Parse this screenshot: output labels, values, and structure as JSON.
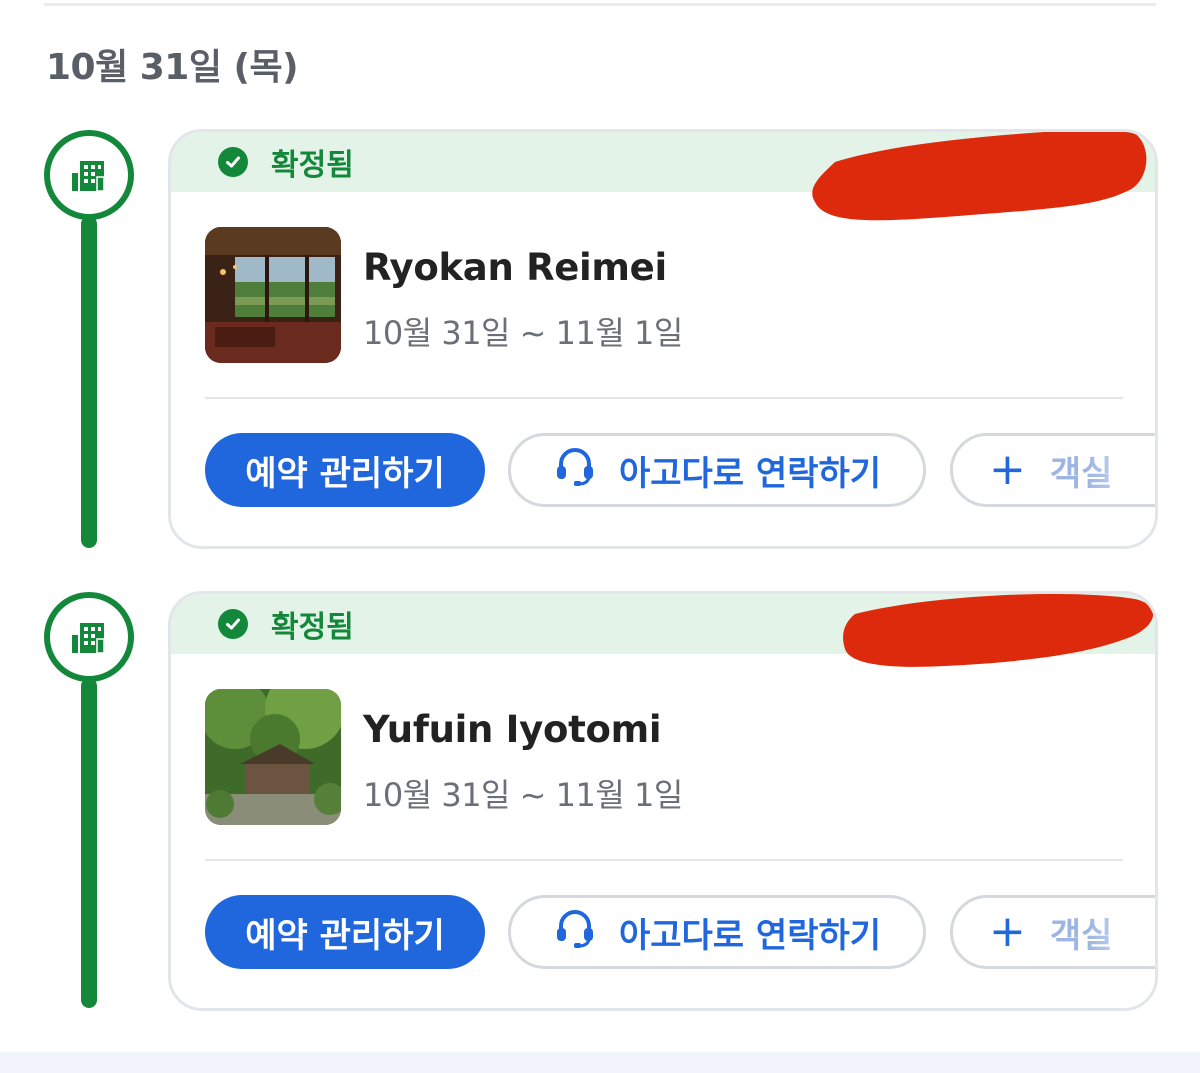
{
  "date_heading": "10월 31일 (목)",
  "colors": {
    "accent_green": "#13883b",
    "status_bg": "#e4f3e7",
    "primary_blue": "#2067de",
    "redaction": "#dd2a0c"
  },
  "bookings": [
    {
      "status": "확정됨",
      "hotel_name": "Ryokan Reimei",
      "dates": "10월 31일 ~ 11월 1일",
      "actions": {
        "manage": "예약 관리하기",
        "contact": "아고다로 연락하기",
        "add_room": "객실"
      },
      "icons": {
        "status": "check-circle-icon",
        "timeline": "building-icon",
        "contact": "headset-icon",
        "add": "plus-icon"
      }
    },
    {
      "status": "확정됨",
      "hotel_name": "Yufuin Iyotomi",
      "dates": "10월 31일 ~ 11월 1일",
      "actions": {
        "manage": "예약 관리하기",
        "contact": "아고다로 연락하기",
        "add_room": "객실"
      },
      "icons": {
        "status": "check-circle-icon",
        "timeline": "building-icon",
        "contact": "headset-icon",
        "add": "plus-icon"
      }
    }
  ]
}
